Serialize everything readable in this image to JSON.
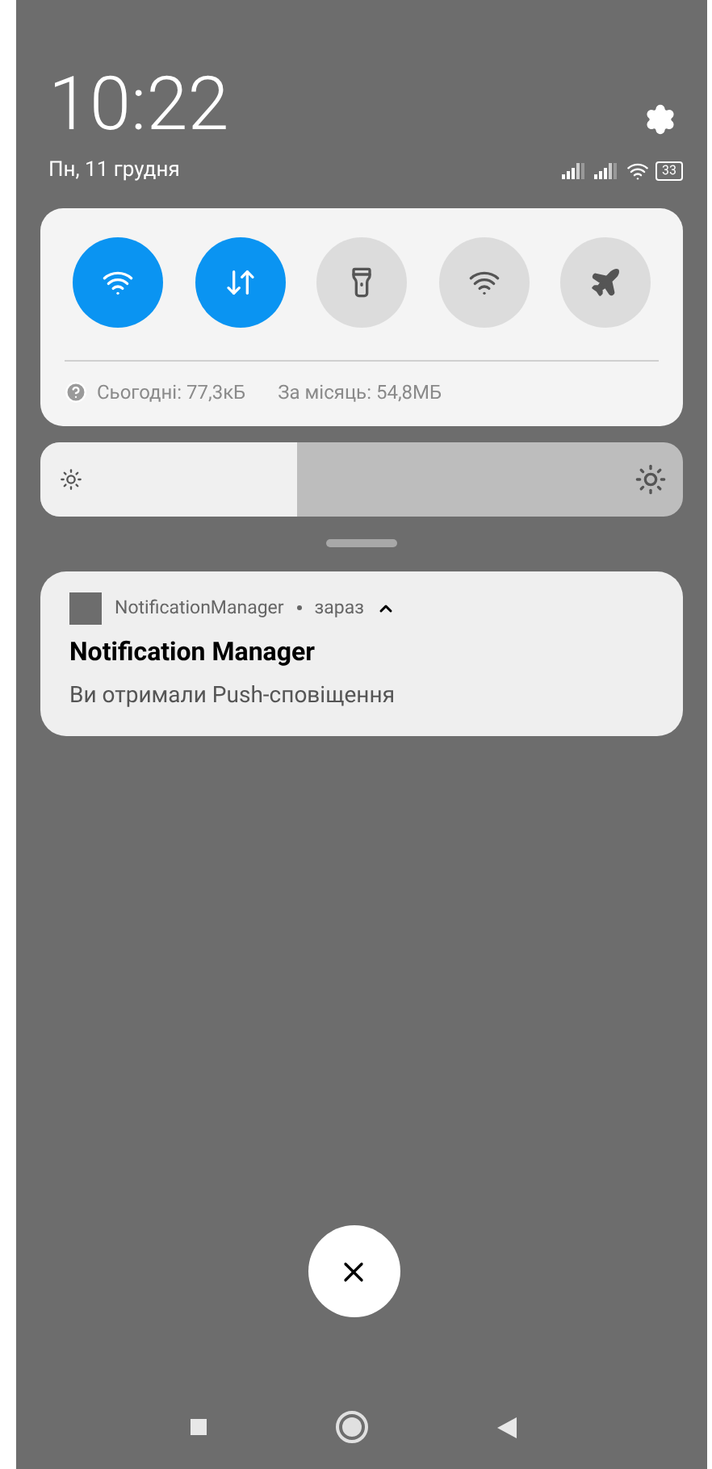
{
  "status": {
    "time": "10:22",
    "date": "Пн, 11 грудня",
    "battery": "33"
  },
  "toggles": [
    {
      "kind": "wifi",
      "on": true
    },
    {
      "kind": "data",
      "on": true
    },
    {
      "kind": "flashlight",
      "on": false
    },
    {
      "kind": "hotspot",
      "on": false
    },
    {
      "kind": "airplane",
      "on": false
    }
  ],
  "usage": {
    "today": "Сьогодні: 77,3кБ",
    "month": "За місяць: 54,8МБ"
  },
  "brightness": {
    "level": 0.4
  },
  "notification": {
    "app": "NotificationManager",
    "time": "зараз",
    "expanded": true,
    "title": "Notification Manager",
    "text": "Ви отримали Push-сповіщення"
  }
}
